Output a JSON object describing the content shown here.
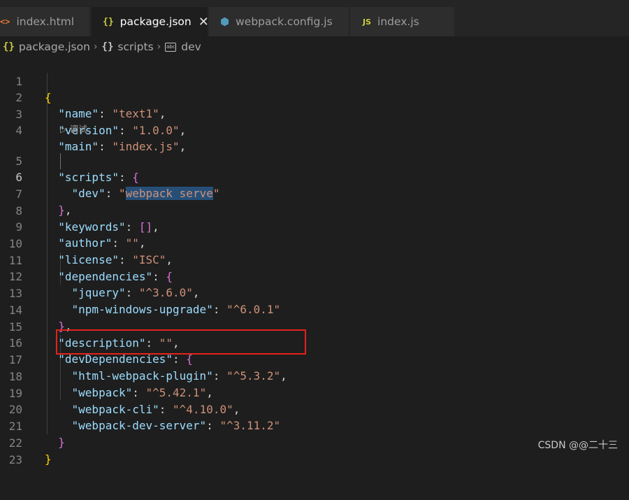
{
  "tabs": [
    {
      "icon": "<>",
      "label": "index.html",
      "active": false
    },
    {
      "icon": "{}",
      "label": "package.json",
      "active": true,
      "close": "✕"
    },
    {
      "icon": "⬢",
      "label": "webpack.config.js",
      "active": false
    },
    {
      "icon": "JS",
      "label": "index.js",
      "active": false
    }
  ],
  "breadcrumb": {
    "file": "package.json",
    "section": "scripts",
    "item": "dev",
    "sep": "›"
  },
  "codelens": "▷ 调试",
  "lines": [
    {
      "n": "1"
    },
    {
      "n": "2"
    },
    {
      "n": "3"
    },
    {
      "n": "4"
    },
    {
      "n": "5"
    },
    {
      "n": "6"
    },
    {
      "n": "7"
    },
    {
      "n": "8"
    },
    {
      "n": "9"
    },
    {
      "n": "10"
    },
    {
      "n": "11"
    },
    {
      "n": "12"
    },
    {
      "n": "13"
    },
    {
      "n": "14"
    },
    {
      "n": "15"
    },
    {
      "n": "16"
    },
    {
      "n": "17"
    },
    {
      "n": "18"
    },
    {
      "n": "19"
    },
    {
      "n": "20"
    },
    {
      "n": "21"
    },
    {
      "n": "22"
    },
    {
      "n": "23"
    }
  ],
  "json": {
    "name": "text1",
    "version": "1.0.0",
    "main": "index.js",
    "dev": "webpack serve",
    "license": "ISC",
    "jquery": "^3.6.0",
    "npm_windows_upgrade": "^6.0.1",
    "html_webpack_plugin": "^5.3.2",
    "webpack": "^5.42.1",
    "webpack_cli": "^4.10.0",
    "webpack_dev_server": "^3.11.2"
  },
  "keys": {
    "name": "\"name\"",
    "version": "\"version\"",
    "main": "\"main\"",
    "scripts": "\"scripts\"",
    "dev": "\"dev\"",
    "keywords": "\"keywords\"",
    "author": "\"author\"",
    "license": "\"license\"",
    "dependencies": "\"dependencies\"",
    "jquery": "\"jquery\"",
    "npm_windows_upgrade": "\"npm-windows-upgrade\"",
    "description": "\"description\"",
    "devDependencies": "\"devDependencies\"",
    "html_webpack_plugin": "\"html-webpack-plugin\"",
    "webpack": "\"webpack\"",
    "webpack_cli": "\"webpack-cli\"",
    "webpack_dev_server": "\"webpack-dev-server\""
  },
  "values": {
    "name": "\"text1\"",
    "version": "\"1.0.0\"",
    "main": "\"index.js\"",
    "dev_open": "\"",
    "dev_sel": "webpack serve",
    "dev_close": "\"",
    "empty": "\"\"",
    "license": "\"ISC\"",
    "jquery": "\"^3.6.0\"",
    "npm_windows_upgrade": "\"^6.0.1\"",
    "html_webpack_plugin": "\"^5.3.2\"",
    "webpack": "\"^5.42.1\"",
    "webpack_cli": "\"^4.10.0\"",
    "webpack_dev_server": "\"^3.11.2\""
  },
  "watermark": "CSDN @@二十三",
  "colors": {
    "background": "#1e1e1e",
    "key": "#9cdcfe",
    "string": "#ce9178",
    "bracket_gold": "#ffd700",
    "bracket_purple": "#da70d6",
    "selection": "#264f78",
    "highlight_box": "#e2231a"
  }
}
